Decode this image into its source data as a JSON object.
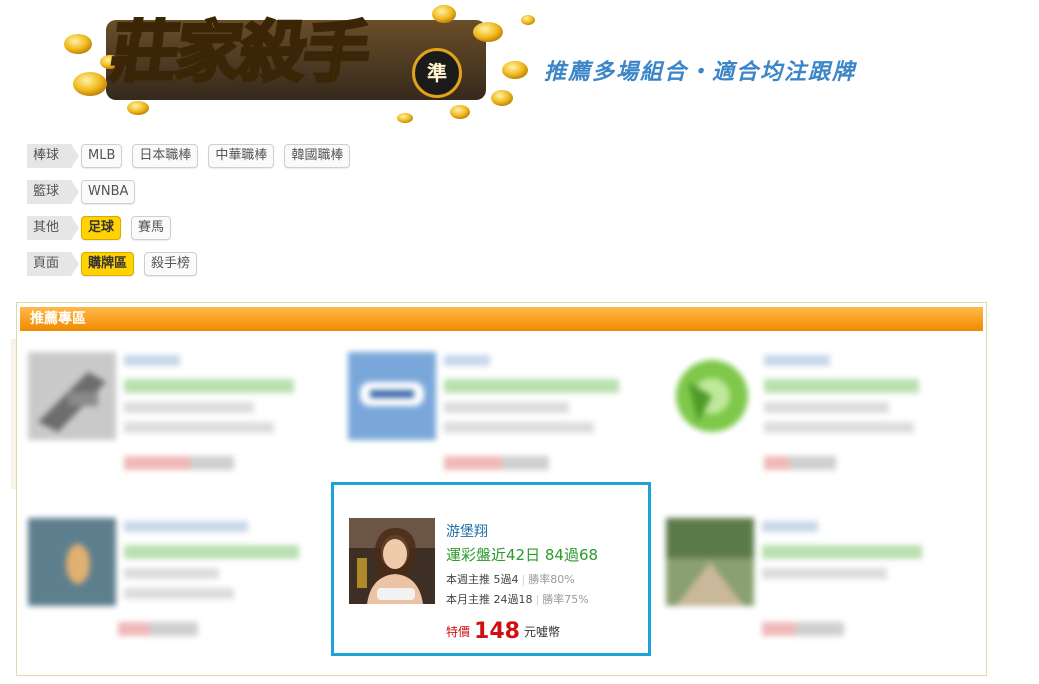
{
  "header": {
    "logo_text": "莊家殺手",
    "logo_badge": "準",
    "slogan": "推薦多場組合・適合均注跟牌"
  },
  "filters": [
    {
      "category": "棒球",
      "options": [
        {
          "label": "MLB",
          "active": false
        },
        {
          "label": "日本職棒",
          "active": false
        },
        {
          "label": "中華職棒",
          "active": false
        },
        {
          "label": "韓國職棒",
          "active": false
        }
      ]
    },
    {
      "category": "籃球",
      "options": [
        {
          "label": "WNBA",
          "active": false
        }
      ]
    },
    {
      "category": "其他",
      "options": [
        {
          "label": "足球",
          "active": true
        },
        {
          "label": "賽馬",
          "active": false
        }
      ]
    },
    {
      "category": "頁面",
      "options": [
        {
          "label": "購牌區",
          "active": true
        },
        {
          "label": "殺手榜",
          "active": false
        }
      ]
    }
  ],
  "recommend": {
    "title": "推薦專區",
    "featured": {
      "name": "游堡翔",
      "record": "運彩盤近42日 84過68",
      "week_label": "本週主推 5過4",
      "week_rate": "勝率80%",
      "month_label": "本月主推 24過18",
      "month_rate": "勝率75%",
      "price_label": "特價",
      "price": "148",
      "price_unit": "元噓幣"
    }
  },
  "colors": {
    "accent_orange": "#f39200",
    "highlight_border": "#1fa3d6",
    "active_option": "#ffd200",
    "record_green": "#2c9a2c",
    "price_red": "#d01010"
  }
}
